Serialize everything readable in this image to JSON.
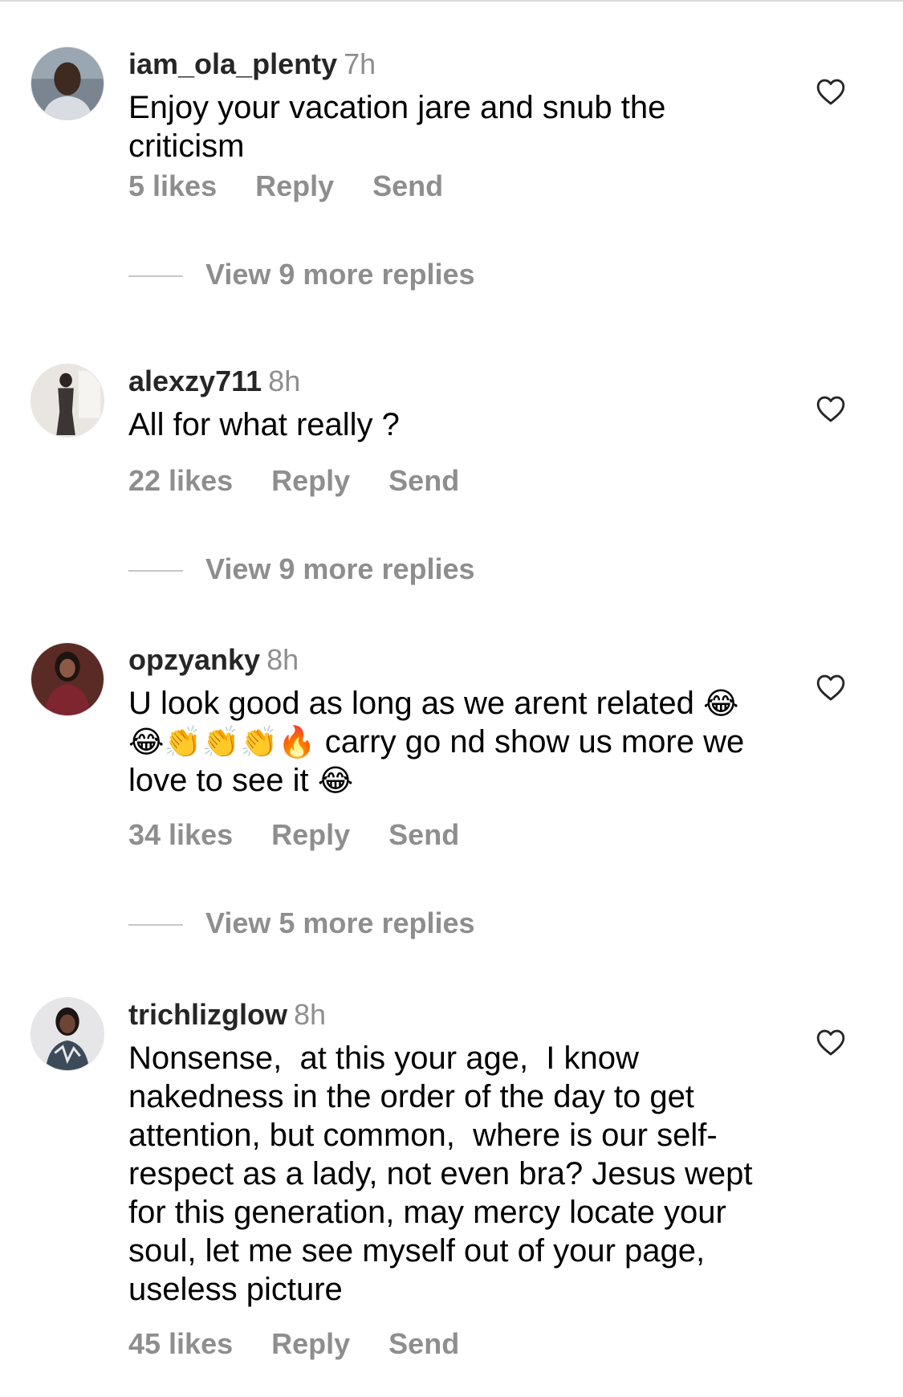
{
  "comments": [
    {
      "username": "iam_ola_plenty",
      "time": "7h",
      "text": "Enjoy your vacation jare and snub the criticism",
      "likes": "5 likes",
      "reply": "Reply",
      "send": "Send",
      "view_more": "View 9 more replies"
    },
    {
      "username": "alexzy711",
      "time": "8h",
      "text": "All for what really ?",
      "likes": "22 likes",
      "reply": "Reply",
      "send": "Send",
      "view_more": "View 9 more replies"
    },
    {
      "username": "opzyanky",
      "time": "8h",
      "text_part1": "U look good as long as we arent related",
      "emojis1": "😂😂👏👏👏🔥",
      "text_part2": "carry go nd show us more we love to see it",
      "emojis2": "😂",
      "likes": "34 likes",
      "reply": "Reply",
      "send": "Send",
      "view_more": "View 5 more replies"
    },
    {
      "username": "trichlizglow",
      "time": "8h",
      "text": "Nonsense,  at this your age,  I know nakedness in the order of the day to get attention, but common,  where is our self-respect as a lady, not even bra? Jesus wept for this generation, may mercy locate your soul, let me see myself out of your page, useless picture",
      "likes": "45 likes",
      "reply": "Reply",
      "send": "Send"
    }
  ],
  "icons": {
    "like": "heart-outline-icon"
  },
  "colors": {
    "secondary_text": "#8e8e8e",
    "username": "#262626"
  }
}
